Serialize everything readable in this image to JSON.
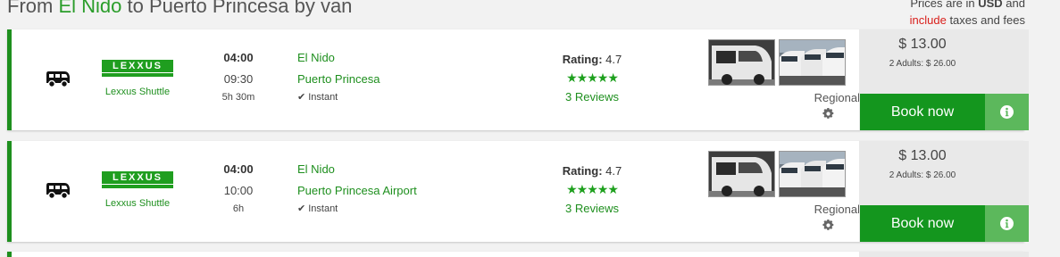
{
  "header": {
    "title_from_prefix": "From ",
    "title_from": "El Nido",
    "title_to_prefix": " to ",
    "title_to": "Puerto Princesa",
    "title_suffix": " by van",
    "price_note_line1_prefix": "Prices are in ",
    "price_note_currency": "USD",
    "price_note_line1_suffix": " and",
    "price_note_include": "include",
    "price_note_line2_suffix": " taxes and fees"
  },
  "results": [
    {
      "vehicle_icon": "van-icon",
      "operator_logo_text": "LEXXUS",
      "operator_name": "Lexxus Shuttle",
      "departure_time": "04:00",
      "arrival_time": "09:30",
      "duration": "5h 30m",
      "from_station": "El Nido",
      "to_station": "Puerto Princesa",
      "booking_type": "Instant",
      "rating_label": "Rating:",
      "rating_value": "4.7",
      "stars": 5,
      "reviews": "3 Reviews",
      "class": "Regional",
      "price": "$ 13.00",
      "adults_price": "2 Adults: $ 26.00",
      "book_label": "Book now"
    },
    {
      "vehicle_icon": "van-icon",
      "operator_logo_text": "LEXXUS",
      "operator_name": "Lexxus Shuttle",
      "departure_time": "04:00",
      "arrival_time": "10:00",
      "duration": "6h",
      "from_station": "El Nido",
      "to_station": "Puerto Princesa Airport",
      "booking_type": "Instant",
      "rating_label": "Rating:",
      "rating_value": "4.7",
      "stars": 5,
      "reviews": "3 Reviews",
      "class": "Regional",
      "price": "$ 13.00",
      "adults_price": "2 Adults: $ 26.00",
      "book_label": "Book now"
    }
  ],
  "colors": {
    "brand_green": "#1e8f1e",
    "book_button": "#14961e",
    "info_button": "#5cb85c",
    "star": "#1ea01e",
    "include_red": "#d9201c"
  }
}
